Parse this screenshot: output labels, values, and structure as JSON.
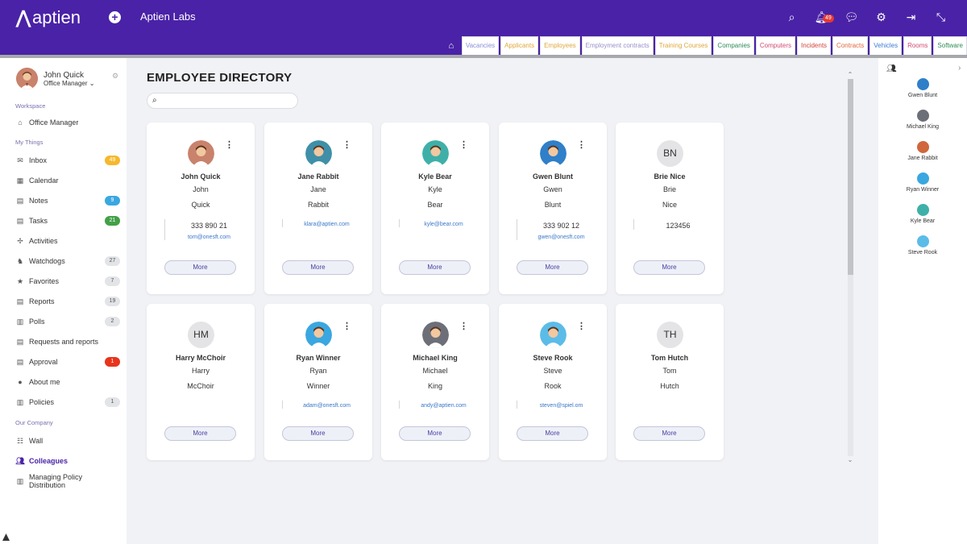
{
  "header": {
    "logo_text": "aptien",
    "company": "Aptien Labs",
    "notification_count": "49",
    "tabs": [
      {
        "label": "Vacancies",
        "color": "#8a8fd6"
      },
      {
        "label": "Applicants",
        "color": "#e0a73c"
      },
      {
        "label": "Employees",
        "color": "#e0a73c"
      },
      {
        "label": "Employment contracts",
        "color": "#9a8fc9"
      },
      {
        "label": "Training Courses",
        "color": "#e0a73c"
      },
      {
        "label": "Companies",
        "color": "#2e8b57"
      },
      {
        "label": "Computers",
        "color": "#d04a73"
      },
      {
        "label": "Incidents",
        "color": "#d0443a"
      },
      {
        "label": "Contracts",
        "color": "#e0683c"
      },
      {
        "label": "Vehicles",
        "color": "#3a7bd5"
      },
      {
        "label": "Rooms",
        "color": "#d04a73"
      },
      {
        "label": "Software",
        "color": "#2e8b57"
      }
    ]
  },
  "sidebar": {
    "user_name": "John Quick",
    "user_role": "Office Manager",
    "section_workspace": "Workspace",
    "office_manager": "Office Manager",
    "section_mythings": "My Things",
    "items": [
      {
        "label": "Inbox",
        "badge": "49"
      },
      {
        "label": "Calendar",
        "badge": ""
      },
      {
        "label": "Notes",
        "badge": "9"
      },
      {
        "label": "Tasks",
        "badge": "21"
      },
      {
        "label": "Activities",
        "badge": ""
      },
      {
        "label": "Watchdogs",
        "badge": "27"
      },
      {
        "label": "Favorites",
        "badge": "7"
      },
      {
        "label": "Reports",
        "badge": "19"
      },
      {
        "label": "Polls",
        "badge": "2"
      },
      {
        "label": "Requests and reports",
        "badge": ""
      },
      {
        "label": "Approval",
        "badge": "1"
      },
      {
        "label": "About me",
        "badge": ""
      },
      {
        "label": "Policies",
        "badge": "1"
      }
    ],
    "section_company": "Our Company",
    "company_items": [
      {
        "label": "Wall"
      },
      {
        "label": "Colleagues"
      },
      {
        "label": "Managing Policy Distribution"
      }
    ]
  },
  "main": {
    "title": "EMPLOYEE DIRECTORY",
    "search_placeholder": "",
    "more_label": "More",
    "employees": [
      {
        "full": "John Quick",
        "first": "John",
        "last": "Quick",
        "phone": "333 890 21",
        "email": "tom@onesft.com",
        "initials": "",
        "avatar_color": "#c9826b"
      },
      {
        "full": "Jane Rabbit",
        "first": "Jane",
        "last": "Rabbit",
        "phone": "",
        "email": "klara@aptien.com",
        "initials": "",
        "avatar_color": "#3f8fa8"
      },
      {
        "full": "Kyle Bear",
        "first": "Kyle",
        "last": "Bear",
        "phone": "",
        "email": "kyle@bear.com",
        "initials": "",
        "avatar_color": "#3fb0a8"
      },
      {
        "full": "Gwen Blunt",
        "first": "Gwen",
        "last": "Blunt",
        "phone": "333 902 12",
        "email": "gwen@onesft.com",
        "initials": "",
        "avatar_color": "#2f7fc9"
      },
      {
        "full": "Brie Nice",
        "first": "Brie",
        "last": "Nice",
        "phone": "123456",
        "email": "",
        "initials": "BN",
        "avatar_color": ""
      },
      {
        "full": "Harry McChoir",
        "first": "Harry",
        "last": "McChoir",
        "phone": "",
        "email": "",
        "initials": "HM",
        "avatar_color": ""
      },
      {
        "full": "Ryan Winner",
        "first": "Ryan",
        "last": "Winner",
        "phone": "",
        "email": "adam@onesft.com",
        "initials": "",
        "avatar_color": "#3aa7e0"
      },
      {
        "full": "Michael King",
        "first": "Michael",
        "last": "King",
        "phone": "",
        "email": "andy@aptien.com",
        "initials": "",
        "avatar_color": "#6d6f78"
      },
      {
        "full": "Steve Rook",
        "first": "Steve",
        "last": "Rook",
        "phone": "",
        "email": "steven@spiel.om",
        "initials": "",
        "avatar_color": "#5bbce8"
      },
      {
        "full": "Tom Hutch",
        "first": "Tom",
        "last": "Hutch",
        "phone": "",
        "email": "",
        "initials": "TH",
        "avatar_color": ""
      }
    ]
  },
  "right_panel": {
    "people": [
      {
        "name": "Gwen Blunt",
        "color": "#2f7fc9"
      },
      {
        "name": "Michael King",
        "color": "#6d6f78"
      },
      {
        "name": "Jane Rabbit",
        "color": "#d0663c"
      },
      {
        "name": "Ryan Winner",
        "color": "#3aa7e0"
      },
      {
        "name": "Kyle Bear",
        "color": "#3fb0a8"
      },
      {
        "name": "Steve Rook",
        "color": "#5bbce8"
      }
    ]
  }
}
